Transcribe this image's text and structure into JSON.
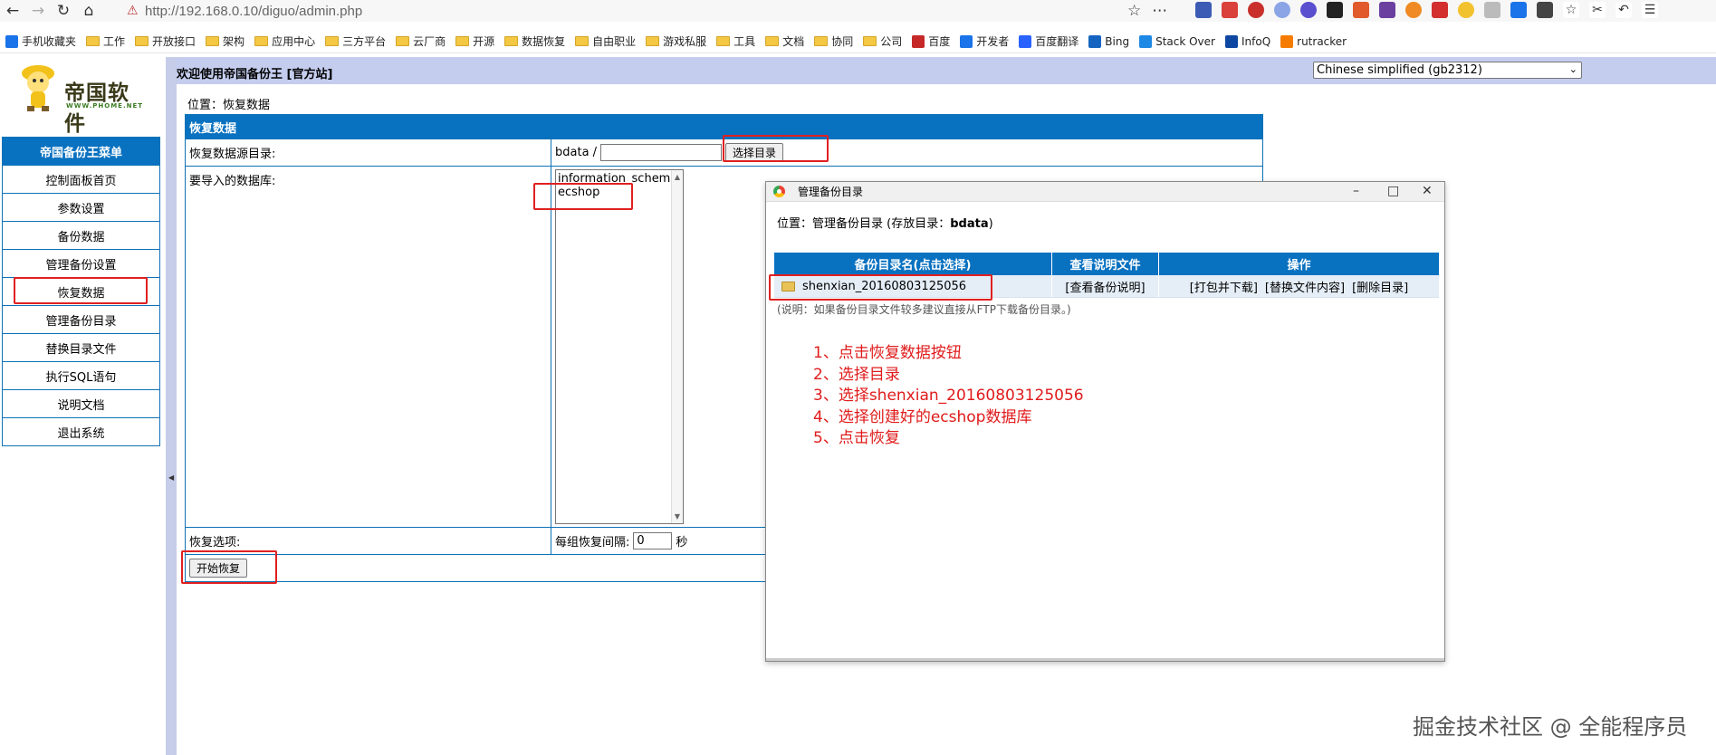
{
  "browser": {
    "url": "http://192.168.0.10/diguo/admin.php",
    "bookmarks": [
      "手机收藏夹",
      "工作",
      "开放接口",
      "架构",
      "应用中心",
      "三方平台",
      "云厂商",
      "开源",
      "数据恢复",
      "自由职业",
      "游戏私服",
      "工具",
      "文档",
      "协同",
      "公司",
      "百度",
      "开发者",
      "百度翻译",
      "Bing",
      "Stack Over",
      "InfoQ",
      "rutracker"
    ]
  },
  "sidebar": {
    "logo_text": "帝国软件",
    "logo_sub": "WWW.PHOME.NET",
    "menu_title": "帝国备份王菜单",
    "items": [
      "控制面板首页",
      "参数设置",
      "备份数据",
      "管理备份设置",
      "恢复数据",
      "管理备份目录",
      "替换目录文件",
      "执行SQL语句",
      "说明文档",
      "退出系统"
    ]
  },
  "main": {
    "welcome": "欢迎使用帝国备份王 [官方站]",
    "language": "Chinese simplified (gb2312)",
    "location": "位置：恢复数据",
    "form_title": "恢复数据",
    "source_dir_label": "恢复数据源目录:",
    "source_dir_prefix": "bdata /",
    "select_dir_button": "选择目录",
    "db_label": "要导入的数据库:",
    "databases": [
      "information_schema",
      "ecshop"
    ],
    "options_label": "恢复选项:",
    "interval_label": "每组恢复间隔:",
    "interval_value": "0",
    "interval_unit": "秒",
    "start_button": "开始恢复"
  },
  "popup": {
    "title": "管理备份目录",
    "location_prefix": "位置：管理备份目录 (存放目录：",
    "location_dir": "bdata",
    "location_suffix": ")",
    "headers": [
      "备份目录名(点击选择)",
      "查看说明文件",
      "操作"
    ],
    "rows": [
      {
        "name": "shenxian_20160803125056",
        "view": "[查看备份说明]",
        "actions": [
          "[打包并下载]",
          "[替换文件内容]",
          "[删除目录]"
        ]
      }
    ],
    "note": "(说明：如果备份目录文件较多建议直接从FTP下载备份目录。)",
    "steps": [
      "1、点击恢复数据按钮",
      "2、选择目录",
      "3、选择shenxian_20160803125056",
      "4、选择创建好的ecshop数据库",
      "5、点击恢复"
    ]
  },
  "watermark": "掘金技术社区 @ 全能程序员",
  "colors": {
    "header_blue": "#0871c0",
    "annotation_red": "#e02020",
    "frame_bar": "#c4cdee"
  }
}
